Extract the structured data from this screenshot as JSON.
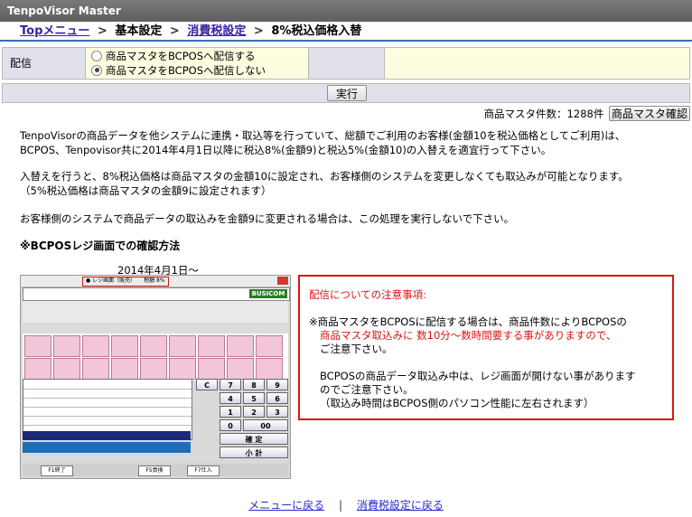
{
  "window": {
    "title": "TenpoVisor Master"
  },
  "breadcrumb": {
    "items": [
      {
        "label": "Topメニュー",
        "link": true
      },
      {
        "label": "基本設定",
        "link": false
      },
      {
        "label": "消費税設定",
        "link": true
      },
      {
        "label": "8%税込価格入替",
        "link": false
      }
    ],
    "separator": ">"
  },
  "delivery": {
    "label": "配信",
    "options": [
      {
        "label": "商品マスタをBCPOSへ配信する",
        "checked": false
      },
      {
        "label": "商品マスタをBCPOSへ配信しない",
        "checked": true
      }
    ]
  },
  "execute_button": "実行",
  "product_count": {
    "text": "商品マスタ件数：1288件",
    "button": "商品マスタ確認"
  },
  "description": [
    "TenpoVisorの商品データを他システムに連携・取込等を行っていて、総額でご利用のお客様(金額10を税込価格としてご利用)は、",
    "BCPOS、Tenpovisor共に2014年4月1日以降に税込8%(金額9)と税込5%(金額10)の入替えを適宜行って下さい。",
    "",
    "入替えを行うと、8%税込価格は商品マスタの金額10に設定され、お客様側のシステムを変更しなくても取込みが可能となります。",
    "（5%税込価格は商品マスタの金額9に設定されます）",
    "",
    "お客様側のシステムで商品データの取込みを金額9に変更される場合は、この処理を実行しないで下さい。"
  ],
  "confirm_heading": "※BCPOSレジ画面での確認方法",
  "screenshot_caption": "2014年4月1日～",
  "pos_screen": {
    "header_label": "● レジ画面（販売）　　税額 8%",
    "brand": "BUSICOM",
    "keypad": [
      "7",
      "8",
      "9",
      "4",
      "5",
      "6",
      "1",
      "2",
      "3",
      "0",
      "00"
    ],
    "confirm_key": "確 定",
    "subtotal_key": "小 計",
    "clear_key": "C",
    "fkeys": [
      "F1終了",
      "F5貢換",
      "F7仕入"
    ]
  },
  "notice": {
    "title": "配信についての注意事項:",
    "lines": [
      "※商品マスタをBCPOSに配信する場合は、商品件数によりBCPOSの",
      "商品マスタ取込みに 数10分～数時間要する事がありますので、",
      "ご注意下さい。",
      "",
      "BCPOSの商品データ取込み中は、レジ画面が開けない事があります",
      "のでご注意下さい。",
      "（取込み時間はBCPOS側のパソコン性能に左右されます）"
    ]
  },
  "footer": {
    "menu_link": "メニューに戻る",
    "separator": "|",
    "tax_link": "消費税設定に戻る"
  },
  "colors": {
    "accent_red": "#d81515",
    "link": "#3a1fa0",
    "label_bg": "#e1e1eb",
    "input_bg": "#fffde0"
  }
}
